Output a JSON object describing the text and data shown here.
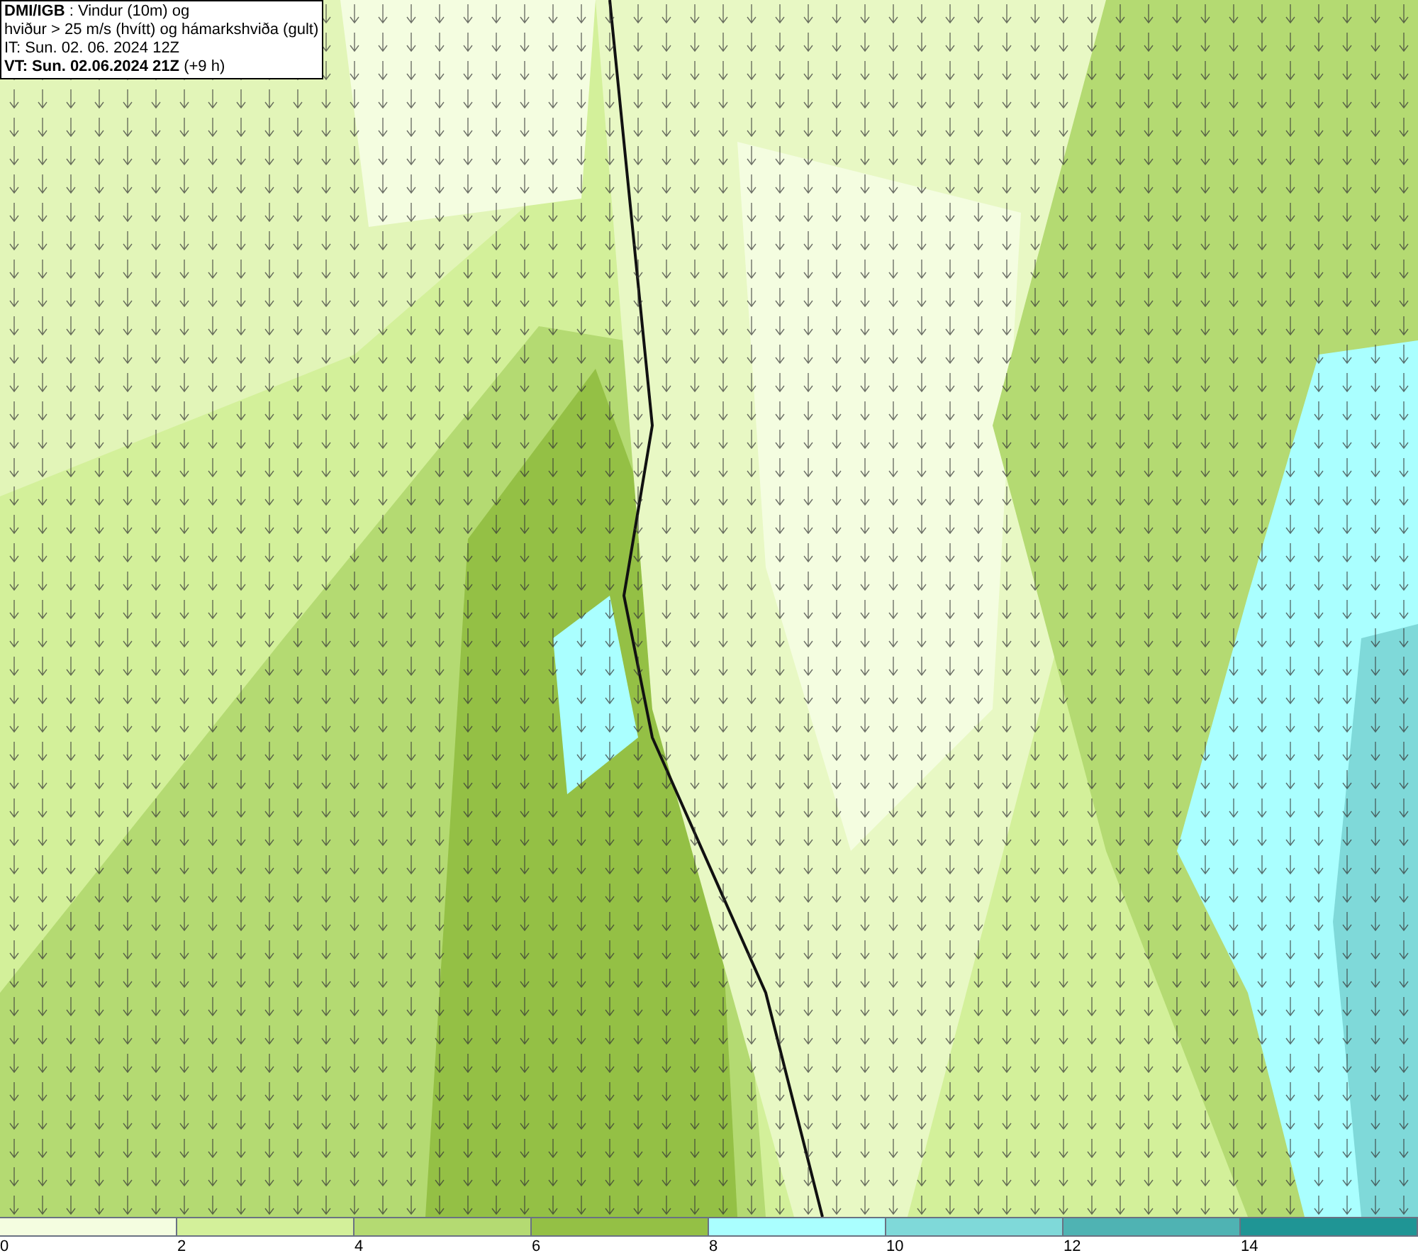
{
  "caption": {
    "lines": [
      "**DMI/IGB** : Vindur (10m) og",
      "hviður > 25 m/s (hvítt) og hámarkshviða (gult)",
      "IT: Sun. 02. 06. 2024 12Z",
      "**VT: Sun. 02.06.2024 21Z** (+9 h)"
    ]
  },
  "legend": [
    {
      "label": "0",
      "color": "#f4fde0"
    },
    {
      "label": "2",
      "color": "#d3f09a"
    },
    {
      "label": "4",
      "color": "#b4da72"
    },
    {
      "label": "6",
      "color": "#94c045"
    },
    {
      "label": "8",
      "color": "#aaffff"
    },
    {
      "label": "10",
      "color": "#7fd9d9"
    },
    {
      "label": "12",
      "color": "#4fb3b3"
    },
    {
      "label": "14",
      "color": "#1f9595"
    }
  ]
}
